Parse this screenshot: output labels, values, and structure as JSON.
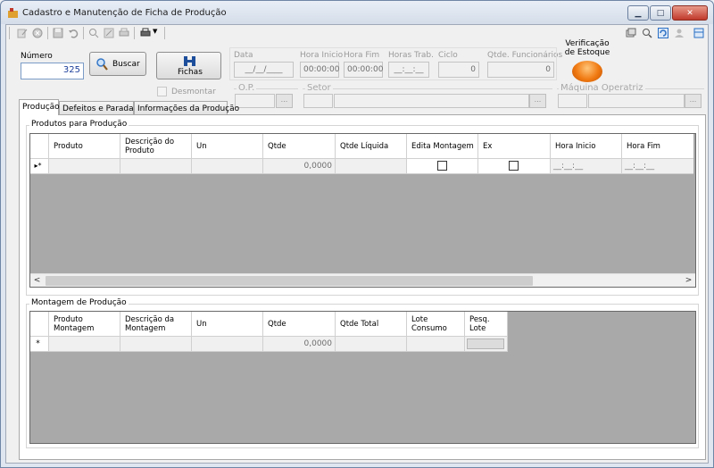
{
  "window": {
    "title": "Cadastro e Manutenção de Ficha de Produção",
    "minimize_icon": "minimize-icon",
    "maximize_icon": "maximize-icon",
    "close_icon": "close-icon"
  },
  "header": {
    "numero_label": "Número",
    "numero_value": "325",
    "buscar_label": "Buscar",
    "fichas_label": "Fichas",
    "desmontar_label": "Desmontar",
    "data_label": "Data",
    "data_value": "__/__/____",
    "hora_inicio_label": "Hora Inicio",
    "hora_inicio_value": "00:00:00",
    "hora_fim_label": "Hora Fim",
    "hora_fim_value": "00:00:00",
    "horas_trab_label": "Horas Trab.",
    "horas_trab_value": "__:__:__",
    "ciclo_label": "Ciclo",
    "ciclo_value": "0",
    "qtde_funcionarios_label": "Qtde. Funcionários",
    "qtde_funcionarios_value": "0",
    "verificacao_label": "Verificação de Estoque",
    "op_label": "O.P.",
    "setor_label": "Setor",
    "maquina_label": "Máquina Operatriz",
    "dots": "..."
  },
  "tabs": [
    {
      "label": "Produção",
      "active": true
    },
    {
      "label": "Defeitos e Paradas",
      "active": false
    },
    {
      "label": "Informações da Produção",
      "active": false
    }
  ],
  "produtos": {
    "title": "Produtos para Produção",
    "columns": [
      "Produto",
      "Descrição do Produto",
      "Un",
      "Qtde",
      "Qtde Líquida",
      "Edita Montagem",
      "Ex",
      "Hora Inicio",
      "Hora Fim"
    ],
    "row_marker": "▸*",
    "row": {
      "qtde": "0,0000",
      "hora_inicio": "__:__:__",
      "hora_fim": "__:__:__"
    }
  },
  "montagem": {
    "title": "Montagem de Produção",
    "columns": [
      "Produto Montagem",
      "Descrição da Montagem",
      "Un",
      "Qtde",
      "Qtde Total",
      "Lote Consumo",
      "Pesq. Lote"
    ],
    "row_marker": "*",
    "row": {
      "qtde": "0,0000"
    }
  },
  "scroll": {
    "left_arrow": "<",
    "right_arrow": ">"
  },
  "colors": {
    "accent_blue": "#1d3f9a",
    "grid_bg": "#a9a9a9",
    "stock_orange": "#f07a12"
  }
}
